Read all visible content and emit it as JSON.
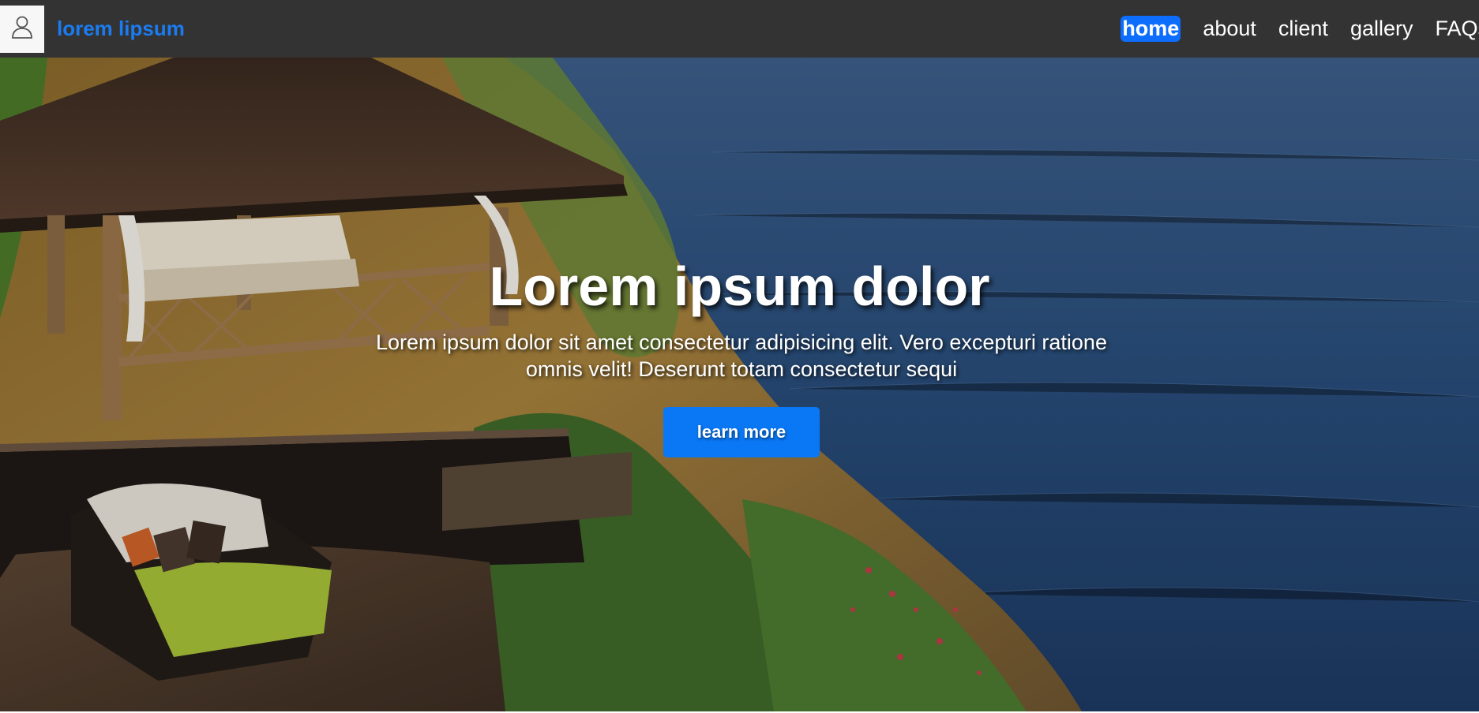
{
  "header": {
    "avatar_icon": "user-icon",
    "brand": "lorem lipsum",
    "brand_color": "#1a7cf0",
    "nav": [
      {
        "label": "home",
        "active": true
      },
      {
        "label": "about",
        "active": false
      },
      {
        "label": "client",
        "active": false
      },
      {
        "label": "gallery",
        "active": false
      },
      {
        "label": "FAQs",
        "active": false
      }
    ]
  },
  "hero": {
    "title": "Lorem ipsum dolor",
    "subtitle": "Lorem ipsum dolor sit amet consectetur adipisicing elit. Vero excepturi ratione omnis velit! Deserunt totam consectetur sequi",
    "button_label": "learn more",
    "button_color": "#0a77f5",
    "background": "clifftop-resort-ocean-photo"
  }
}
